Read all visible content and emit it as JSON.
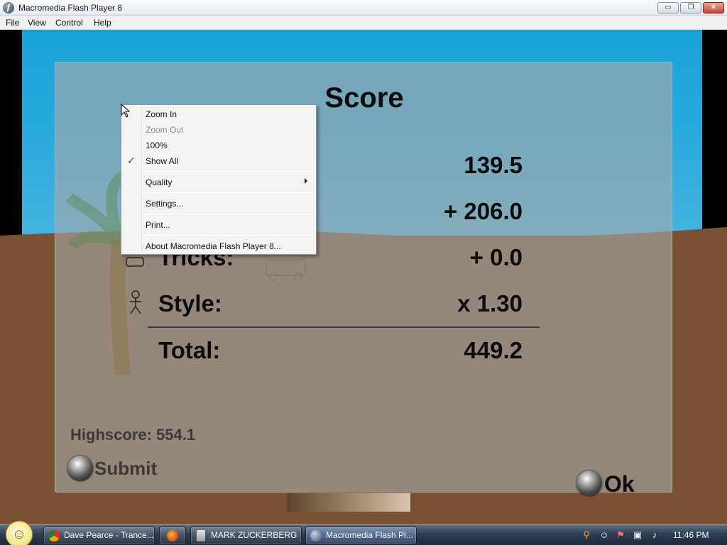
{
  "window": {
    "title": "Macromedia Flash Player 8",
    "controls": {
      "minimize": "▭",
      "maximize": "❐",
      "close": "✕"
    }
  },
  "menubar": {
    "items": [
      "File",
      "View",
      "Control",
      "Help"
    ]
  },
  "game": {
    "score_title": "Score",
    "rows": [
      {
        "label": "",
        "value": "139.5"
      },
      {
        "label": "",
        "value": "+ 206.0"
      },
      {
        "label": "Tricks:",
        "value": "+ 0.0"
      },
      {
        "label": "Style:",
        "value": "x 1.30"
      }
    ],
    "total": {
      "label": "Total:",
      "value": "449.2"
    },
    "highscore": "Highscore: 554.1",
    "submit_label": "Submit",
    "ok_label": "Ok",
    "colors": {
      "sky": "#1aa3d8",
      "ground": "#7a5233",
      "overlay": "#a8a8a8"
    }
  },
  "context_menu": {
    "items": [
      {
        "label": "Zoom In",
        "enabled": true,
        "checked": false
      },
      {
        "label": "Zoom Out",
        "enabled": false,
        "checked": false
      },
      {
        "label": "100%",
        "enabled": true,
        "checked": false
      },
      {
        "label": "Show All",
        "enabled": true,
        "checked": true
      },
      {
        "label": "Quality",
        "enabled": true,
        "submenu": true
      },
      {
        "label": "Settings...",
        "enabled": true
      },
      {
        "label": "Print...",
        "enabled": true
      },
      {
        "label": "About Macromedia Flash Player 8...",
        "enabled": true
      }
    ],
    "check_glyph": "✓"
  },
  "taskbar": {
    "tasks": [
      {
        "label": "Dave Pearce - Trance...",
        "icon": "chrome-icon"
      },
      {
        "label": "",
        "icon": "firefox-icon"
      },
      {
        "label": "MARK ZUCKERBERG",
        "icon": "document-icon"
      },
      {
        "label": "Macromedia Flash Pl...",
        "icon": "flash-icon",
        "active": true
      }
    ],
    "tray_icons": [
      "search-tray-icon",
      "smiley-tray-icon",
      "flag-tray-icon",
      "network-tray-icon",
      "volume-tray-icon"
    ],
    "clock": "11:46 PM"
  }
}
